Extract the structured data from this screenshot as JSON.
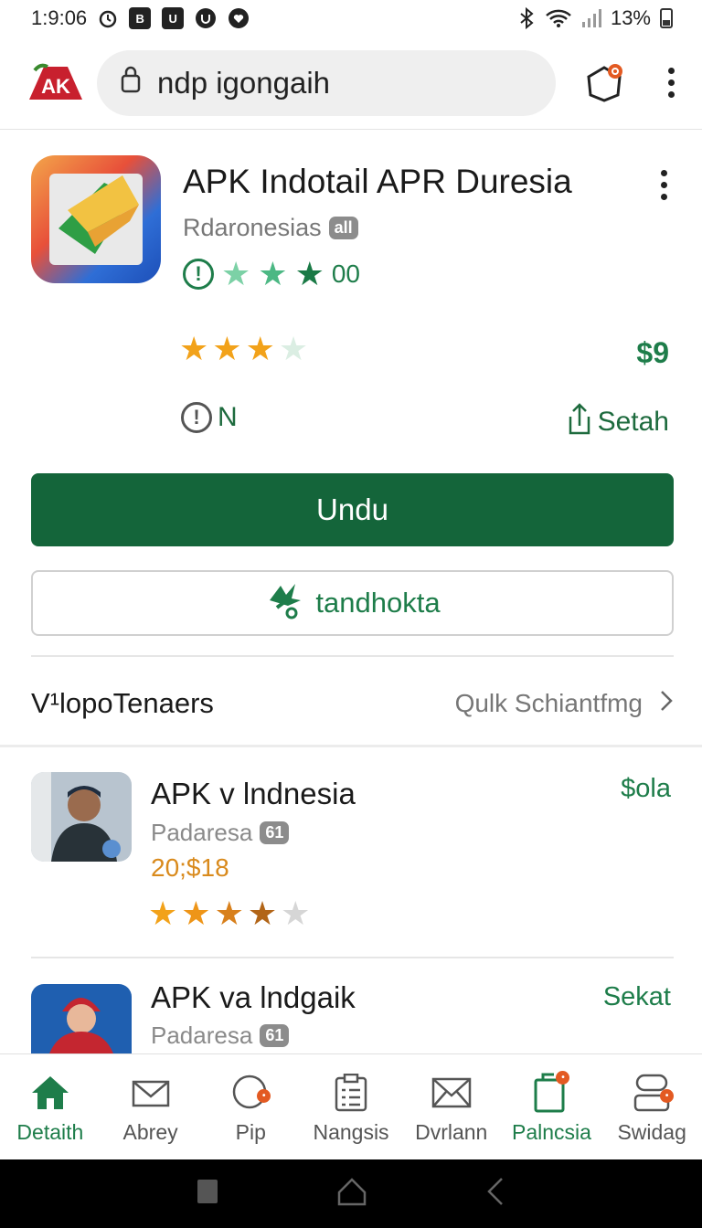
{
  "status_bar": {
    "time": "1:9:06",
    "battery": "13%"
  },
  "browser": {
    "address": "ndp igongaih",
    "logo_text": "AK",
    "icon_names": [
      "lock-icon",
      "notification-icon",
      "more-icon"
    ]
  },
  "app": {
    "title": "APK Indotail APR Duresia",
    "developer": "Rdaronesias",
    "developer_badge": "all",
    "rating_text": "00",
    "price": "$9",
    "n_label": "N",
    "share_label": "Setah",
    "stars_primary": 3,
    "stars_secondary": 3
  },
  "buttons": {
    "install": "Undu",
    "secondary": "tandhokta"
  },
  "section": {
    "title": "V¹lopoTenaers",
    "link": "Qulk Schiantfmg"
  },
  "list": [
    {
      "title": "APK v lndnesia",
      "subtitle": "Padaresa",
      "badge": "61",
      "extra": "20;$18",
      "price": "$ola",
      "stars": 4
    },
    {
      "title": "APK va lndgaik",
      "subtitle": "Padaresa",
      "badge": "61",
      "price": "Sekat"
    }
  ],
  "bottom_nav": [
    {
      "label": "Detaith",
      "icon": "home-icon",
      "active": true
    },
    {
      "label": "Abrey",
      "icon": "mail-icon"
    },
    {
      "label": "Pip",
      "icon": "chat-icon"
    },
    {
      "label": "Nangsis",
      "icon": "clipboard-icon"
    },
    {
      "label": "Dvrlann",
      "icon": "envelope-icon"
    },
    {
      "label": "Palncsia",
      "icon": "book-icon",
      "active": true
    },
    {
      "label": "Swidag",
      "icon": "account-icon"
    }
  ],
  "colors": {
    "accent": "#14653a",
    "accent_text": "#1e7d4a",
    "star": "#f2a21a",
    "orange": "#d98a1c"
  }
}
